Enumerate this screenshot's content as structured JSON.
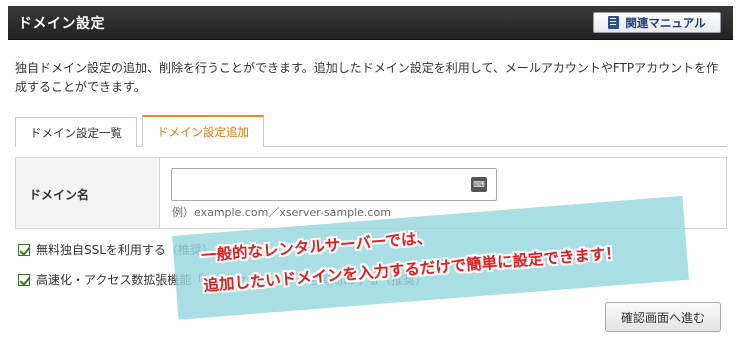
{
  "header": {
    "title": "ドメイン設定",
    "manual_button": "関連マニュアル",
    "manual_icon": "book-icon"
  },
  "description": "独自ドメイン設定の追加、削除を行うことができます。追加したドメイン設定を利用して、メールアカウントやFTPアカウントを作成することができます。",
  "tabs": [
    {
      "label": "ドメイン設定一覧",
      "active": false
    },
    {
      "label": "ドメイン設定追加",
      "active": true
    }
  ],
  "form": {
    "domain_label": "ドメイン名",
    "domain_value": "",
    "example": "例）example.com／xserver-sample.com",
    "input_icon": "keyboard-icon"
  },
  "options": [
    {
      "label": "無料独自SSLを利用する（推奨）",
      "checked": true
    },
    {
      "label": "高速化・アクセス数拡張機能「Xアクセラレータ」を有効にする（推奨）",
      "checked": true
    }
  ],
  "confirm_button": "確認画面へ進む",
  "annotation": {
    "line1": "一般的なレンタルサーバーでは、",
    "line2": "追加したいドメインを入力するだけで簡単に設定できます！"
  },
  "colors": {
    "header_bg": "#2b2b2b",
    "active_tab": "#e07a10",
    "checkbox": "#2d7a16",
    "annotation_bg": "#96d7de",
    "annotation_text": "#e81c1c"
  }
}
